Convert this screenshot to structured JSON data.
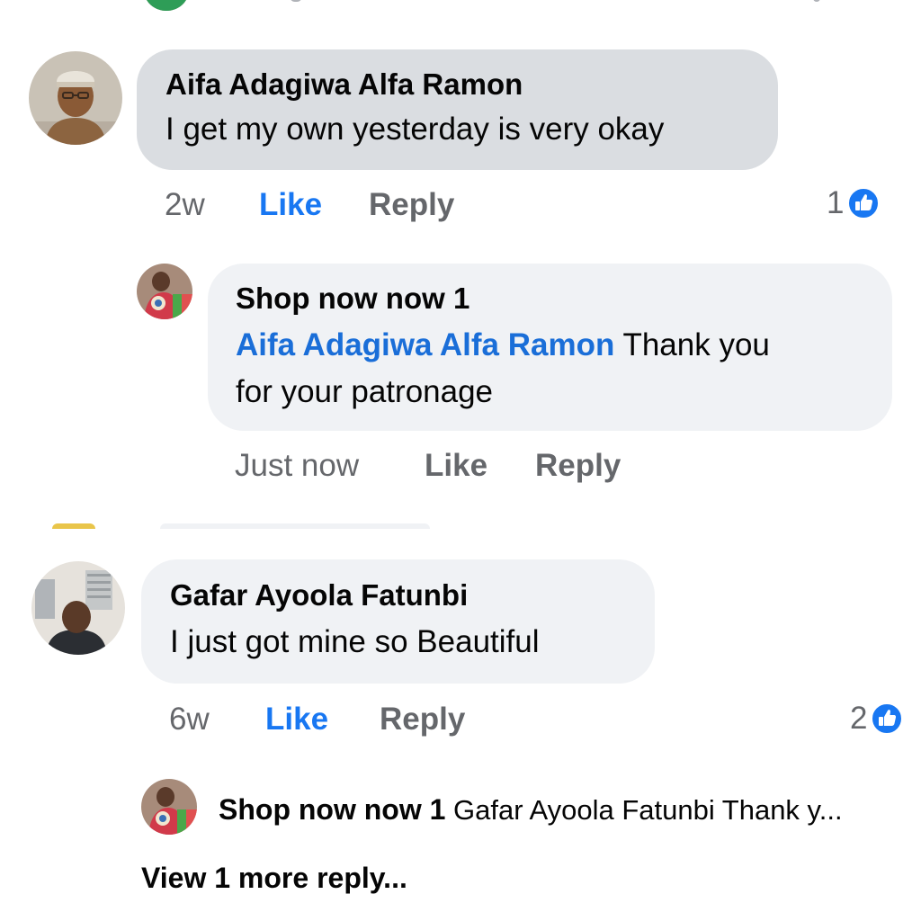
{
  "accent_color": "#1877f2",
  "comments": [
    {
      "author": "Aifa Adagiwa Alfa Ramon",
      "text": "I get my own yesterday is very okay",
      "time": "2w",
      "like_label": "Like",
      "reply_label": "Reply",
      "reaction_count": "1",
      "reaction_icon": "thumbs-up-icon",
      "replies": [
        {
          "author": "Shop now now 1",
          "mention": "Aifa Adagiwa Alfa Ramon",
          "text_line1": "Thank you",
          "text_line2": "for your patronage",
          "time": "Just now",
          "like_label": "Like",
          "reply_label": "Reply"
        }
      ]
    },
    {
      "author": "Gafar Ayoola Fatunbi",
      "text": "I just got mine so Beautiful",
      "time": "6w",
      "like_label": "Like",
      "reply_label": "Reply",
      "reaction_count": "2",
      "reaction_icon": "thumbs-up-icon",
      "reply_preview": {
        "author": "Shop now now 1",
        "text": "Gafar Ayoola Fatunbi Thank y..."
      },
      "view_more_label": "View 1 more reply..."
    }
  ]
}
